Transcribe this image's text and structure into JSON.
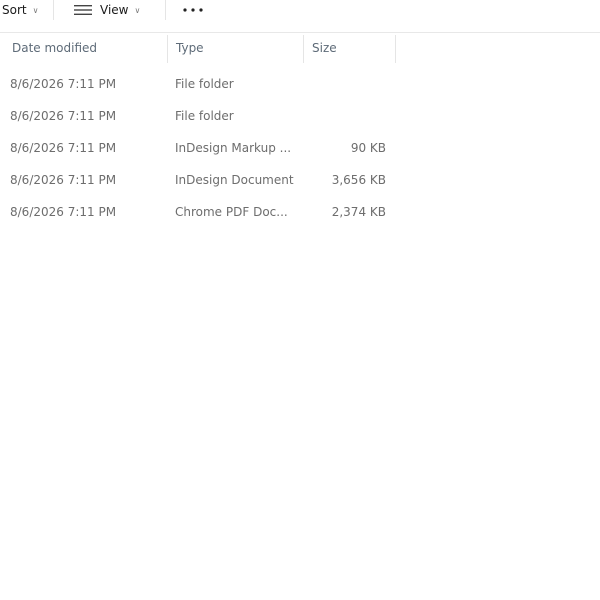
{
  "toolbar": {
    "sort_label": "Sort",
    "view_label": "View",
    "more_label": "..."
  },
  "columns": {
    "date_modified": "Date modified",
    "type": "Type",
    "size": "Size"
  },
  "rows": [
    {
      "date": "8/6/2026 7:11 PM",
      "type": "File folder",
      "size": ""
    },
    {
      "date": "8/6/2026 7:11 PM",
      "type": "File folder",
      "size": ""
    },
    {
      "date": "8/6/2026 7:11 PM",
      "type": "InDesign Markup ...",
      "size": "90 KB"
    },
    {
      "date": "8/6/2026 7:11 PM",
      "type": "InDesign Document",
      "size": "3,656 KB"
    },
    {
      "date": "8/6/2026 7:11 PM",
      "type": "Chrome PDF Doc...",
      "size": "2,374 KB"
    }
  ],
  "icons": {
    "sort_chevron": "chevron-down-icon",
    "view_icon": "view-lines-icon",
    "view_chevron": "chevron-down-icon",
    "more_icon": "more-icon"
  }
}
